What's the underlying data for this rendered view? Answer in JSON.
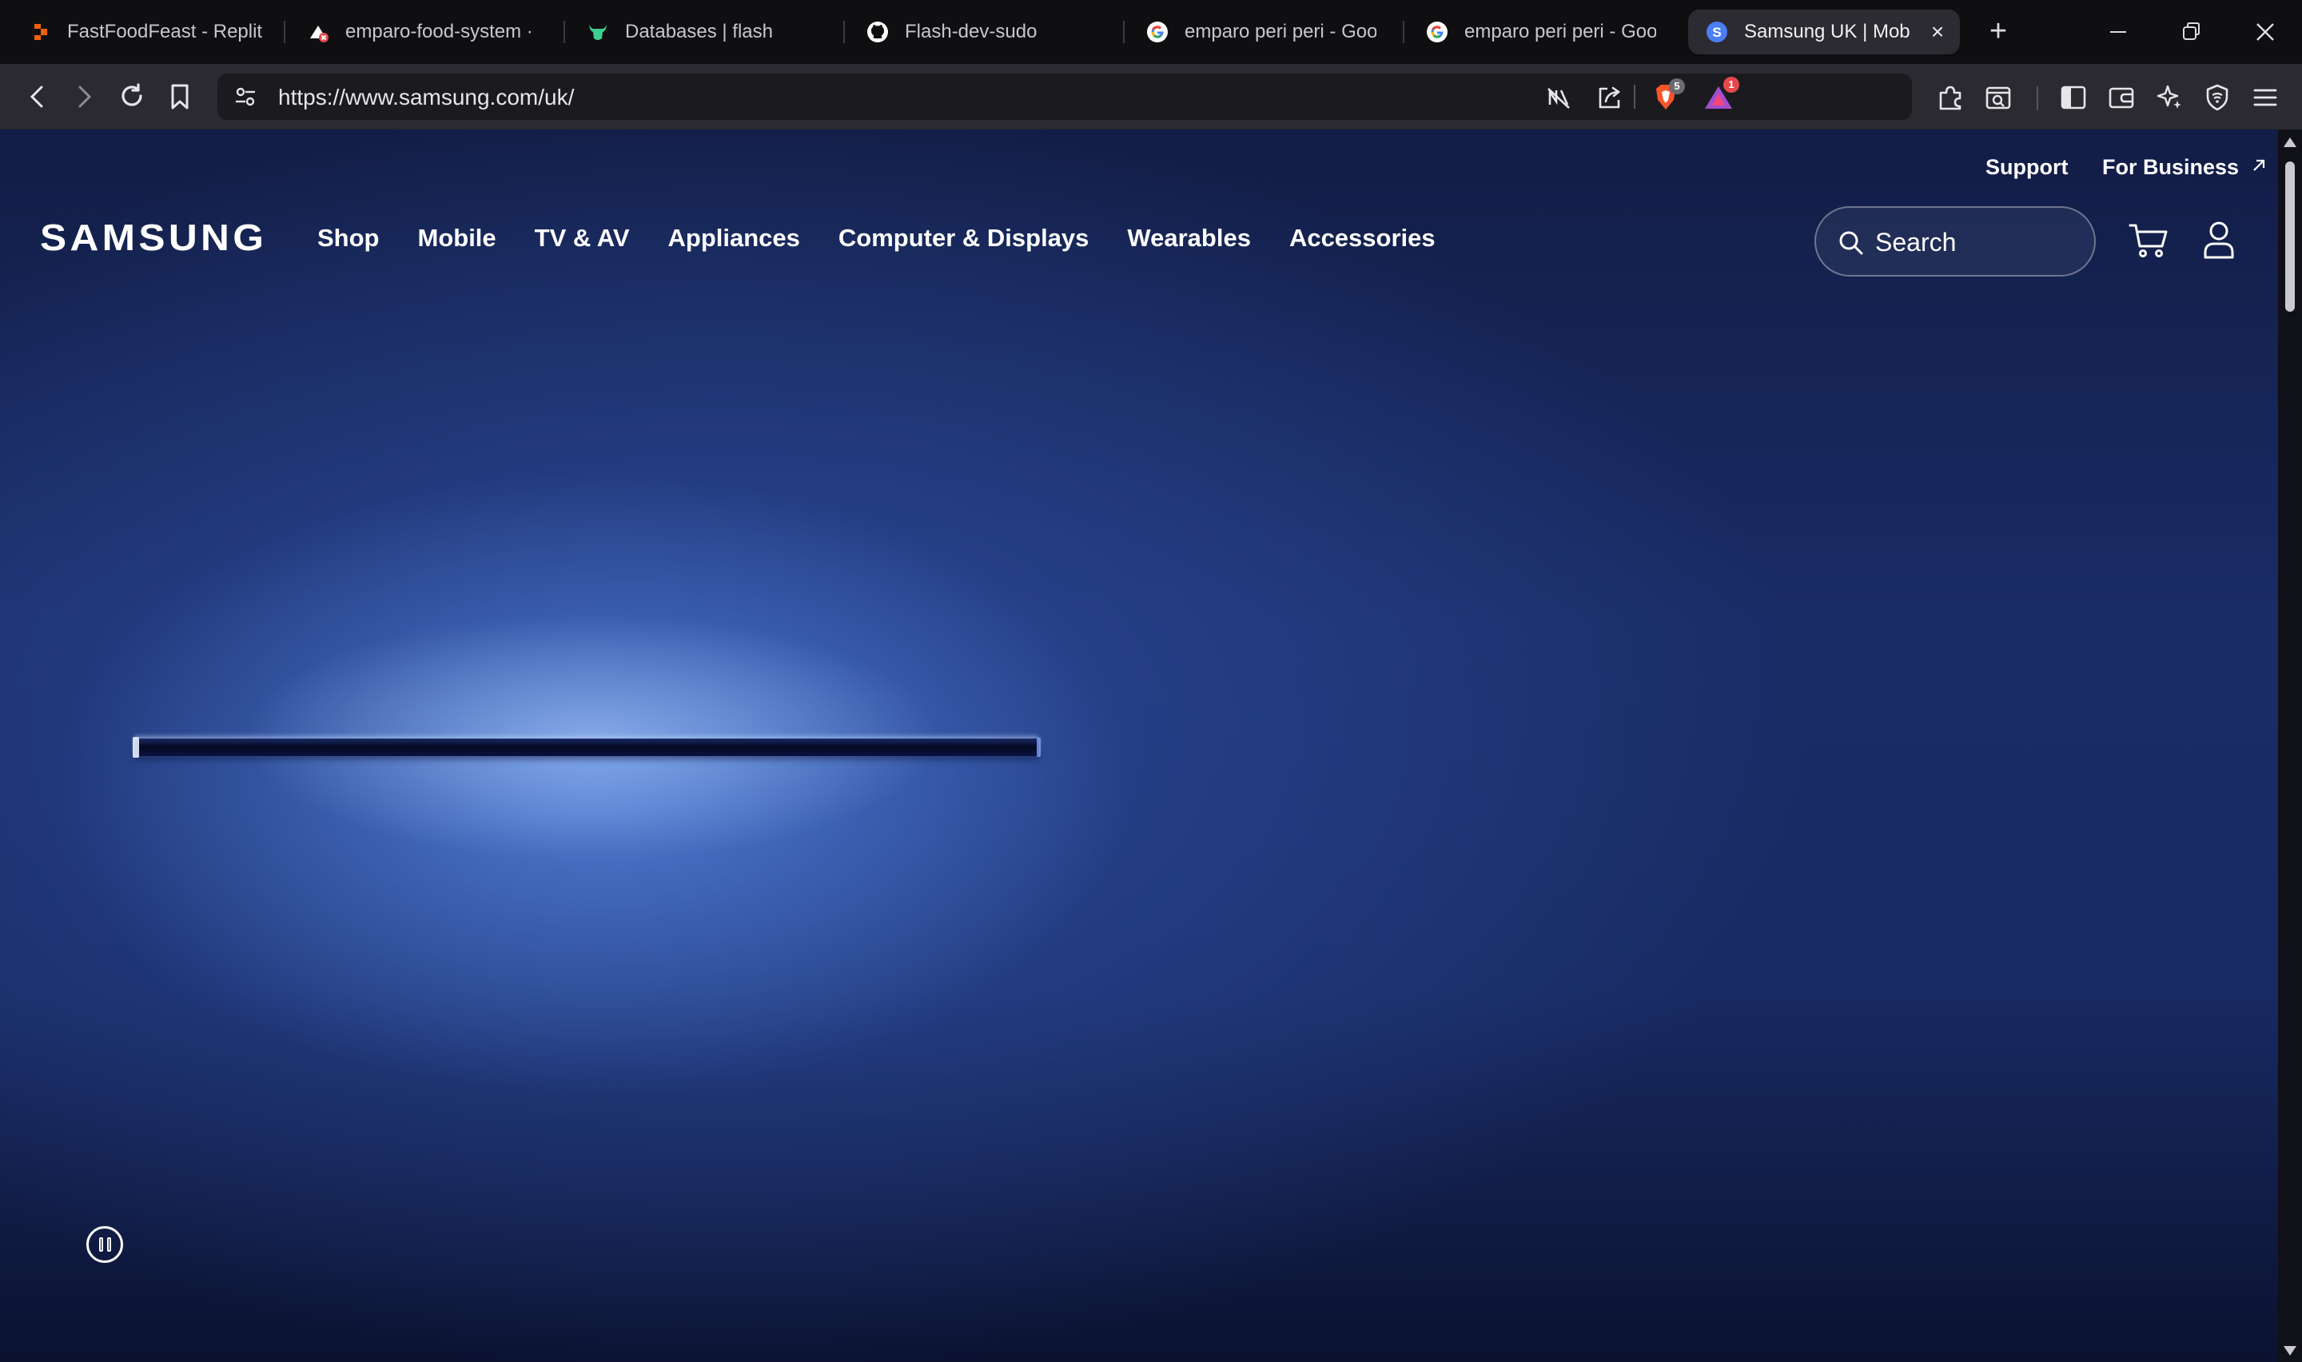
{
  "browser": {
    "tabs": [
      {
        "title": "FastFoodFeast - Replit",
        "icon": "replit-icon"
      },
      {
        "title": "emparo-food-system ·",
        "icon": "vercel-error-icon"
      },
      {
        "title": "Databases | flash",
        "icon": "bull-icon"
      },
      {
        "title": "Flash-dev-sudo",
        "icon": "github-icon"
      },
      {
        "title": "emparo peri peri - Goog",
        "icon": "google-icon"
      },
      {
        "title": "emparo peri peri - Goog",
        "icon": "google-icon"
      },
      {
        "title": "Samsung UK | Mob",
        "icon": "samsung-favicon",
        "active": true
      }
    ],
    "url": "https://www.samsung.com/uk/",
    "brave_shields_count": "5",
    "brave_rewards_count": "1"
  },
  "header": {
    "utility": {
      "support": "Support",
      "business": "For Business"
    },
    "logo": "SAMSUNG",
    "nav": [
      "Shop",
      "Mobile",
      "TV & AV",
      "Appliances",
      "Computer & Displays",
      "Wearables",
      "Accessories"
    ],
    "search": {
      "placeholder": "Search"
    }
  },
  "colors": {
    "page_bg": "#1a2c66",
    "browser_chrome": "#2a2a30",
    "tabstrip": "#0f0f11"
  }
}
